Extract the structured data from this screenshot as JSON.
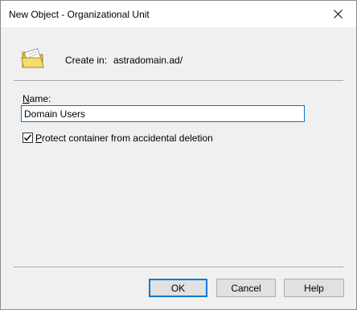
{
  "window": {
    "title": "New Object - Organizational Unit"
  },
  "header": {
    "icon": "organizational-unit-folder-icon",
    "create_in_label": "Create in:",
    "create_in_value": "astradomain.ad/"
  },
  "form": {
    "name_label_prefix": "N",
    "name_label_rest": "ame:",
    "name_value": "Domain Users",
    "protect_checked": true,
    "protect_label_prefix": "P",
    "protect_label_rest": "rotect container from accidental deletion"
  },
  "buttons": {
    "ok": "OK",
    "cancel": "Cancel",
    "help": "Help"
  },
  "colors": {
    "focus_blue": "#0078d7",
    "dialog_bg": "#f0f0f0",
    "button_bg": "#e1e1e1"
  }
}
